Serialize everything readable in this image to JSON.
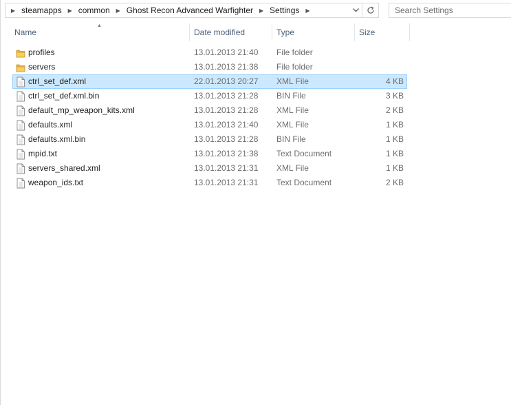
{
  "address": {
    "crumbs": [
      "steamapps",
      "common",
      "Ghost Recon Advanced Warfighter",
      "Settings"
    ]
  },
  "search": {
    "placeholder": "Search Settings"
  },
  "columns": {
    "name": "Name",
    "date": "Date modified",
    "type": "Type",
    "size": "Size"
  },
  "files": [
    {
      "name": "profiles",
      "date": "13.01.2013 21:40",
      "type": "File folder",
      "size": "",
      "icon": "folder-icon"
    },
    {
      "name": "servers",
      "date": "13.01.2013 21:38",
      "type": "File folder",
      "size": "",
      "icon": "folder-icon"
    },
    {
      "name": "ctrl_set_def.xml",
      "date": "22.01.2013 20:27",
      "type": "XML File",
      "size": "4 KB",
      "icon": "file-icon",
      "selected": true
    },
    {
      "name": "ctrl_set_def.xml.bin",
      "date": "13.01.2013 21:28",
      "type": "BIN File",
      "size": "3 KB",
      "icon": "file-icon"
    },
    {
      "name": "default_mp_weapon_kits.xml",
      "date": "13.01.2013 21:28",
      "type": "XML File",
      "size": "2 KB",
      "icon": "file-icon"
    },
    {
      "name": "defaults.xml",
      "date": "13.01.2013 21:40",
      "type": "XML File",
      "size": "1 KB",
      "icon": "file-icon"
    },
    {
      "name": "defaults.xml.bin",
      "date": "13.01.2013 21:28",
      "type": "BIN File",
      "size": "1 KB",
      "icon": "file-icon"
    },
    {
      "name": "mpid.txt",
      "date": "13.01.2013 21:38",
      "type": "Text Document",
      "size": "1 KB",
      "icon": "file-icon"
    },
    {
      "name": "servers_shared.xml",
      "date": "13.01.2013 21:31",
      "type": "XML File",
      "size": "1 KB",
      "icon": "file-icon"
    },
    {
      "name": "weapon_ids.txt",
      "date": "13.01.2013 21:31",
      "type": "Text Document",
      "size": "2 KB",
      "icon": "file-icon"
    }
  ],
  "colors": {
    "selection_bg": "#cce8ff",
    "selection_border": "#99d1ff",
    "header_text": "#4c607a",
    "folder": "#e8b640"
  }
}
